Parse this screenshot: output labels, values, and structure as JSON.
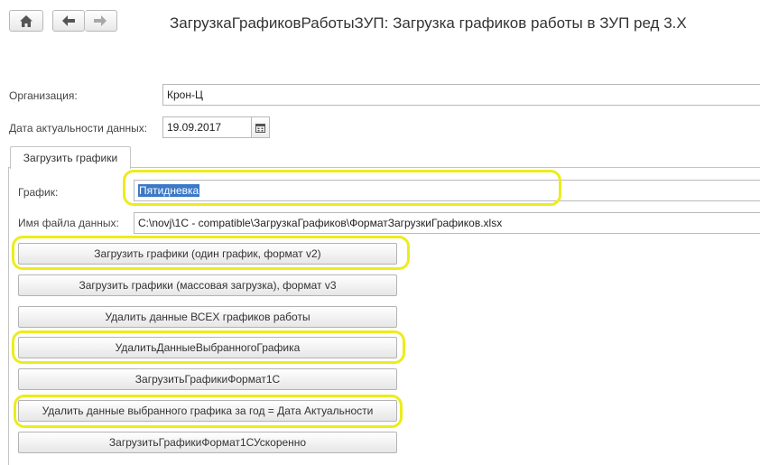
{
  "header": {
    "title": "ЗагрузкаГрафиковРаботыЗУП: Загрузка графиков работы в ЗУП ред 3.X",
    "icons": [
      "home-icon",
      "back-arrow-icon",
      "forward-arrow-icon"
    ]
  },
  "form": {
    "organization_label": "Организация:",
    "organization_value": "Крон-Ц",
    "date_label": "Дата актуальности данных:",
    "date_value": "19.09.2017",
    "date_icon": "calendar-icon"
  },
  "tab": {
    "label": "Загрузить графики"
  },
  "schedule": {
    "label": "График:",
    "value": "Пятидневка"
  },
  "file": {
    "label": "Имя файла данных:",
    "value": "C:\\novj\\1C - compatible\\ЗагрузкаГрафиков\\ФорматЗагрузкиГрафиков.xlsx"
  },
  "buttons": [
    {
      "label": "Загрузить графики (один график, формат v2)"
    },
    {
      "label": "Загрузить графики (массовая загрузка), формат v3"
    },
    {
      "label": "Удалить данные ВСЕХ графиков работы"
    },
    {
      "label": "УдалитьДанныеВыбранногоГрафика"
    },
    {
      "label": "ЗагрузитьГрафикиФормат1С"
    },
    {
      "label": "Удалить данные выбранного графика за год = Дата Актуальности"
    },
    {
      "label": "ЗагрузитьГрафикиФормат1СУскоренно"
    }
  ],
  "colors": {
    "highlight": "#ecec1c",
    "selection": "#3b79c6"
  }
}
